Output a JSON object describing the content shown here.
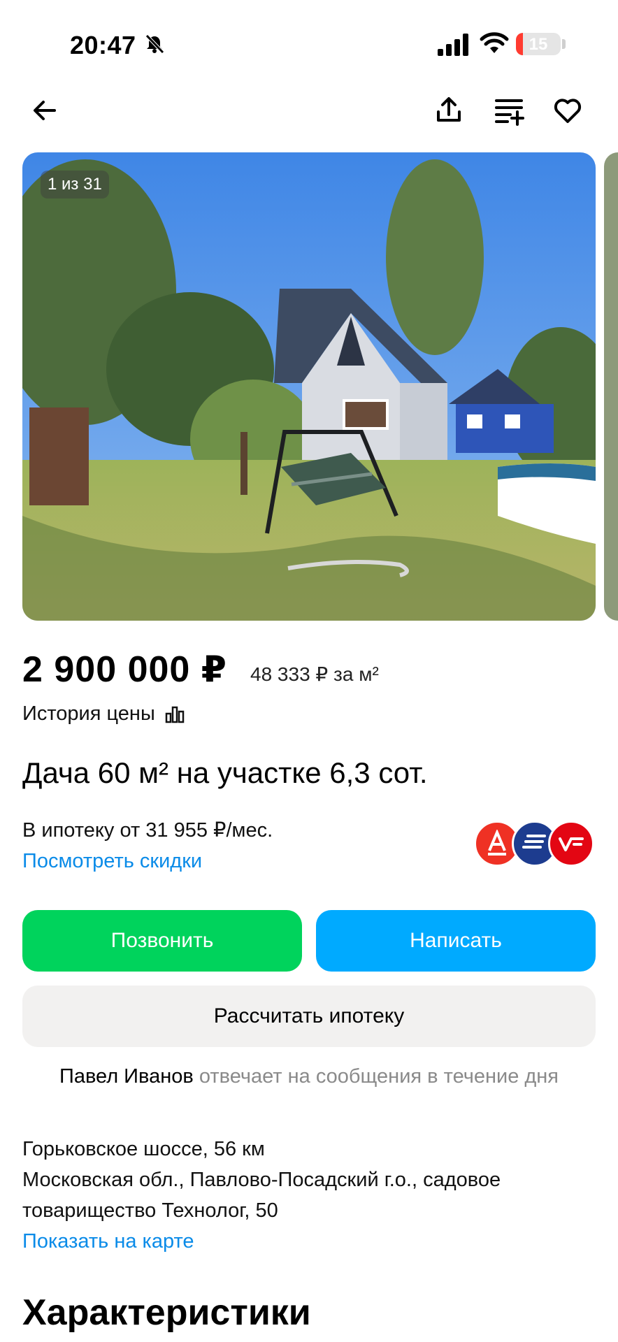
{
  "status_bar": {
    "time": "20:47",
    "battery_percent": "15",
    "battery_level": 0.15,
    "icons": [
      "bell-slash-icon",
      "signal-icon",
      "wifi-icon",
      "battery-icon"
    ]
  },
  "nav": {
    "icons": [
      "arrow-back-icon",
      "share-icon",
      "compare-icon",
      "heart-icon"
    ]
  },
  "gallery": {
    "counter": "1 из 31",
    "current_index": 1,
    "total": 31
  },
  "listing": {
    "price": "2 900 000 ₽",
    "price_per_m2": "48 333 ₽ за м²",
    "price_history_label": "История цены",
    "title": "Дача 60 м² на участке 6,3 сот.",
    "mortgage_text": "В ипотеку от 31 955 ₽/мес.",
    "discounts_link": "Посмотреть скидки",
    "bank_colors": [
      "#ef3124",
      "#1d3c8f",
      "#e30613"
    ]
  },
  "actions": {
    "call_label": "Позвонить",
    "write_label": "Написать",
    "calc_label": "Рассчитать ипотеку",
    "colors": {
      "call": "#00d35c",
      "write": "#00aaff",
      "calc": "#f2f1f0"
    }
  },
  "seller": {
    "name": "Павел Иванов",
    "response_note": "отвечает на сообщения в течение дня"
  },
  "address": {
    "highway": "Горьковское шоссе, 56 км",
    "line": "Московская обл., Павлово-Посадский г.о., садовое товарищество Технолог, 50",
    "map_link": "Показать на карте"
  },
  "section": {
    "title": "Характеристики"
  }
}
